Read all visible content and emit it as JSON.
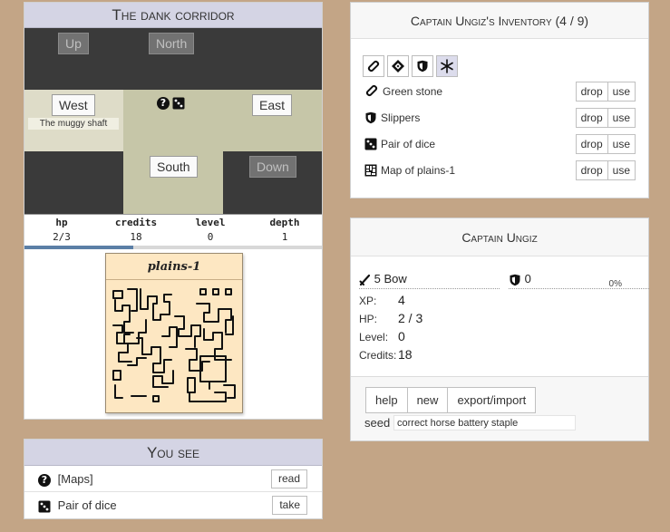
{
  "colors": {
    "background": "#c3a586",
    "title_bar": "#d4d4e4",
    "room_dark": "#3a3a3a",
    "room_light": "#c6c6a8",
    "map_paper": "#fde7c2",
    "hp_bar": "#5b7fa6"
  },
  "room": {
    "title": "The dank corridor",
    "exits": {
      "up": "Up",
      "north": "North",
      "west": "West",
      "east": "East",
      "south": "South",
      "down": "Down"
    },
    "west_label": "The muggy shaft",
    "floor_icons": [
      "question-icon",
      "dice-icon"
    ]
  },
  "stats": {
    "hp_label": "hp",
    "hp_value": "2/3",
    "hp_fraction": 0.667,
    "credits_label": "credits",
    "credits_value": "18",
    "level_label": "level",
    "level_value": "0",
    "depth_label": "depth",
    "depth_value": "1"
  },
  "map_card": {
    "title": "plains-1"
  },
  "you_see": {
    "title": "You see",
    "items": [
      {
        "label": "[Maps]",
        "icon": "question-icon",
        "action": "read"
      },
      {
        "label": "Pair of dice",
        "icon": "dice-icon",
        "action": "take"
      }
    ]
  },
  "inventory": {
    "title": "Captain Ungiz's Inventory (4 / 9)",
    "filters": [
      "stone-icon",
      "gem-icon",
      "shield-icon",
      "asterisk-icon"
    ],
    "items": [
      {
        "label": "Green stone",
        "icon": "stone-icon",
        "drop": "drop",
        "use": "use"
      },
      {
        "label": "Slippers",
        "icon": "shield-icon",
        "drop": "drop",
        "use": "use"
      },
      {
        "label": "Pair of dice",
        "icon": "dice-icon",
        "drop": "drop",
        "use": "use"
      },
      {
        "label": "Map of plains-1",
        "icon": "map-icon",
        "drop": "drop",
        "use": "use"
      }
    ]
  },
  "character": {
    "title": "Captain Ungiz",
    "weapon": "5 Bow",
    "armor": "0",
    "armor_pct": "0%",
    "xp_label": "XP:",
    "xp_value": "4",
    "hp_label": "HP:",
    "hp_value": "2 / 3",
    "level_label": "Level:",
    "level_value": "0",
    "credits_label": "Credits:",
    "credits_value": "18",
    "commands": [
      "help",
      "new",
      "export/import"
    ],
    "seed_label": "seed",
    "seed_value": "correct horse battery staple"
  }
}
